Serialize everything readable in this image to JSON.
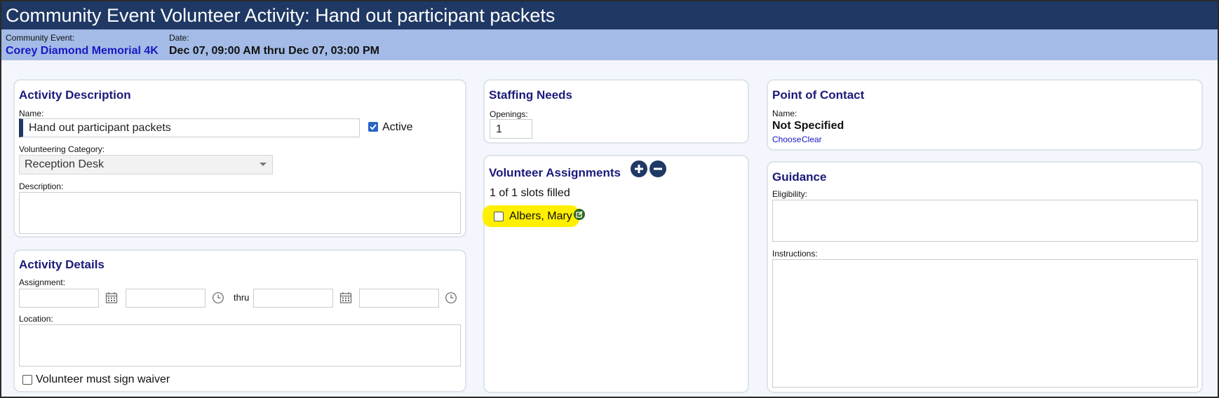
{
  "header": {
    "title": "Community Event Volunteer Activity: Hand out participant packets"
  },
  "info": {
    "event_label": "Community Event:",
    "event_value": "Corey Diamond Memorial 4K",
    "date_label": "Date:",
    "date_value": "Dec 07, 09:00 AM thru Dec 07, 03:00 PM"
  },
  "activity_description": {
    "title": "Activity Description",
    "name_label": "Name:",
    "name_value": "Hand out participant packets",
    "active_label": "Active",
    "active_checked": true,
    "category_label": "Volunteering Category:",
    "category_value": "Reception Desk",
    "description_label": "Description:",
    "description_value": ""
  },
  "activity_details": {
    "title": "Activity Details",
    "assignment_label": "Assignment:",
    "thru_label": "thru",
    "start_date": "",
    "start_time": "",
    "end_date": "",
    "end_time": "",
    "location_label": "Location:",
    "location_value": "",
    "waiver_label": "Volunteer must sign waiver",
    "waiver_checked": false
  },
  "staffing": {
    "title": "Staffing Needs",
    "openings_label": "Openings:",
    "openings_value": "1"
  },
  "assignments": {
    "title": "Volunteer Assignments",
    "slots_text": "1 of 1 slots filled",
    "volunteers": [
      {
        "name": "Albers, Mary",
        "checked": false
      }
    ],
    "highlight_color": "#ffef00"
  },
  "contact": {
    "title": "Point of Contact",
    "name_label": "Name:",
    "name_value": "Not Specified",
    "choose_label": "Choose",
    "clear_label": "Clear"
  },
  "guidance": {
    "title": "Guidance",
    "eligibility_label": "Eligibility:",
    "eligibility_value": "",
    "instructions_label": "Instructions:",
    "instructions_value": ""
  },
  "colors": {
    "title_bar": "#1f3864",
    "info_bar": "#a3bbe6",
    "panel_title": "#1a1a7a",
    "link": "#1a17c4"
  }
}
